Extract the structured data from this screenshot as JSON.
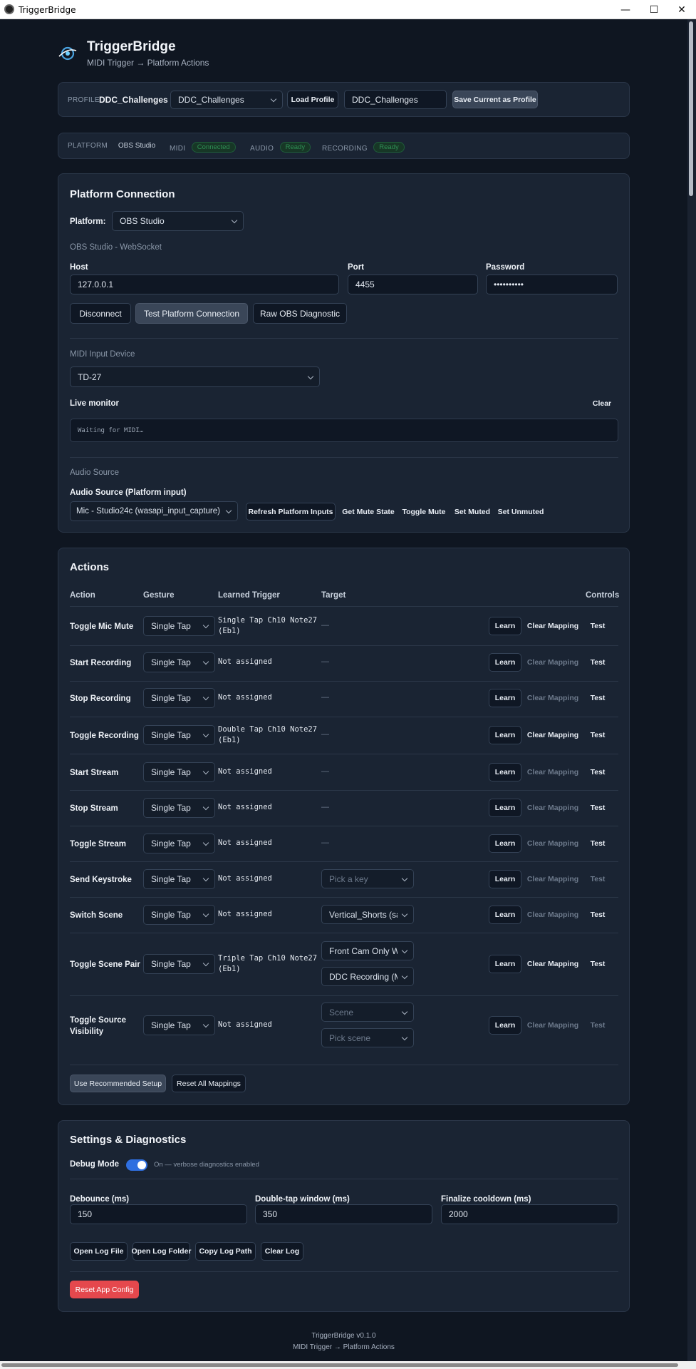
{
  "window": {
    "title": "TriggerBridge"
  },
  "header": {
    "app_name": "TriggerBridge",
    "subtitle": "MIDI Trigger → Platform Actions"
  },
  "profile": {
    "label": "PROFILE",
    "current": "DDC_Challenges",
    "select_value": "DDC_Challenges",
    "load_button": "Load Profile",
    "name_value": "DDC_Challenges",
    "save_button": "Save Current as Profile"
  },
  "status": {
    "platform_label": "PLATFORM",
    "platform_value": "OBS Studio",
    "midi_label": "MIDI",
    "midi_badge": "Connected",
    "audio_label": "AUDIO",
    "audio_badge": "Ready",
    "recording_label": "RECORDING",
    "recording_badge": "Ready",
    "badge_color": "#2f8f55"
  },
  "platform_connection": {
    "title": "Platform Connection",
    "platform_label": "Platform:",
    "platform_value": "OBS Studio",
    "subsection": "OBS Studio - WebSocket",
    "host_label": "Host",
    "host_value": "127.0.0.1",
    "port_label": "Port",
    "port_value": "4455",
    "password_label": "Password",
    "password_value": "••••••••••",
    "disconnect_button": "Disconnect",
    "test_button": "Test Platform Connection",
    "raw_button": "Raw OBS Diagnostic",
    "midi_section": "MIDI Input Device",
    "midi_device": "TD-27",
    "live_monitor_label": "Live monitor",
    "clear_button": "Clear",
    "monitor_text": "Waiting for MIDI…",
    "audio_section": "Audio Source",
    "audio_label": "Audio Source (Platform input)",
    "audio_value": "Mic - Studio24c (wasapi_input_capture)",
    "refresh_button": "Refresh Platform Inputs",
    "get_mute_button": "Get Mute State",
    "toggle_mute_button": "Toggle Mute",
    "set_muted_button": "Set Muted",
    "set_unmuted_button": "Set Unmuted"
  },
  "actions": {
    "title": "Actions",
    "columns": [
      "Action",
      "Gesture",
      "Learned Trigger",
      "Target",
      "Controls"
    ],
    "learn_label": "Learn",
    "clear_label": "Clear Mapping",
    "test_label": "Test",
    "rows": [
      {
        "name": "Toggle Mic Mute",
        "gesture": "Single Tap",
        "trigger": "Single Tap Ch10 Note27\n(Eb1)",
        "target": "—"
      },
      {
        "name": "Start Recording",
        "gesture": "Single Tap",
        "trigger": "Not assigned",
        "target": "—"
      },
      {
        "name": "Stop Recording",
        "gesture": "Single Tap",
        "trigger": "Not assigned",
        "target": "—"
      },
      {
        "name": "Toggle Recording",
        "gesture": "Single Tap",
        "trigger": "Double Tap Ch10 Note27\n(Eb1)",
        "target": "—"
      },
      {
        "name": "Start Stream",
        "gesture": "Single Tap",
        "trigger": "Not assigned",
        "target": "—"
      },
      {
        "name": "Stop Stream",
        "gesture": "Single Tap",
        "trigger": "Not assigned",
        "target": "—"
      },
      {
        "name": "Toggle Stream",
        "gesture": "Single Tap",
        "trigger": "Not assigned",
        "target": "—"
      },
      {
        "name": "Send Keystroke",
        "gesture": "Single Tap",
        "trigger": "Not assigned",
        "target": "Pick a key"
      },
      {
        "name": "Switch Scene",
        "gesture": "Single Tap",
        "trigger": "Not assigned",
        "target": "Vertical_Shorts (save"
      },
      {
        "name": "Toggle Scene Pair",
        "gesture": "Single Tap",
        "trigger": "Triple Tap Ch10 Note27\n(Eb1)",
        "target": "Front Cam Only W/B",
        "target2": "DDC Recording (Ma"
      },
      {
        "name": "Toggle Source\nVisibility",
        "gesture": "Single Tap",
        "trigger": "Not assigned",
        "target": "Scene",
        "target2": "Pick scene"
      }
    ],
    "recommended_button": "Use Recommended Setup",
    "reset_button": "Reset All Mappings"
  },
  "settings": {
    "title": "Settings & Diagnostics",
    "debug_label": "Debug Mode",
    "debug_on": true,
    "debug_status": "On — verbose diagnostics enabled",
    "debounce_label": "Debounce (ms)",
    "debounce_value": "150",
    "double_tap_label": "Double-tap window (ms)",
    "double_tap_value": "350",
    "cooldown_label": "Finalize cooldown (ms)",
    "cooldown_value": "2000",
    "open_log_file": "Open Log File",
    "open_log_folder": "Open Log Folder",
    "copy_log_path": "Copy Log Path",
    "clear_log": "Clear Log",
    "reset_config": "Reset App Config",
    "accent_color": "#2f6fe0",
    "danger_color": "#e5484d"
  },
  "footer": {
    "version": "TriggerBridge v0.1.0",
    "tagline": "MIDI Trigger → Platform Actions"
  }
}
